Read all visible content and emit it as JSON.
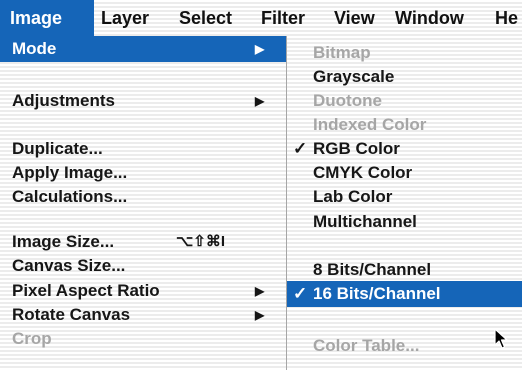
{
  "menubar": {
    "items": [
      "Image",
      "Layer",
      "Select",
      "Filter",
      "View",
      "Window",
      "He"
    ]
  },
  "image_menu": {
    "items": [
      {
        "label": "Mode",
        "arrow": "▶"
      },
      {
        "label": "Adjustments",
        "arrow": "▶"
      },
      {
        "label": "Duplicate..."
      },
      {
        "label": "Apply Image..."
      },
      {
        "label": "Calculations..."
      },
      {
        "label": "Image Size...",
        "shortcut": "⌥⇧⌘I"
      },
      {
        "label": "Canvas Size..."
      },
      {
        "label": "Pixel Aspect Ratio",
        "arrow": "▶"
      },
      {
        "label": "Rotate Canvas",
        "arrow": "▶"
      },
      {
        "label": "Crop"
      }
    ]
  },
  "mode_submenu": {
    "check_mark": "✓",
    "items": [
      {
        "label": "Bitmap"
      },
      {
        "label": "Grayscale"
      },
      {
        "label": "Duotone"
      },
      {
        "label": "Indexed Color"
      },
      {
        "label": "RGB Color"
      },
      {
        "label": "CMYK Color"
      },
      {
        "label": "Lab Color"
      },
      {
        "label": "Multichannel"
      },
      {
        "label": "8 Bits/Channel"
      },
      {
        "label": "16 Bits/Channel"
      },
      {
        "label": "Color Table..."
      }
    ]
  },
  "colors": {
    "highlight": "#1565b8",
    "disabled_text": "#a6a6a6"
  }
}
